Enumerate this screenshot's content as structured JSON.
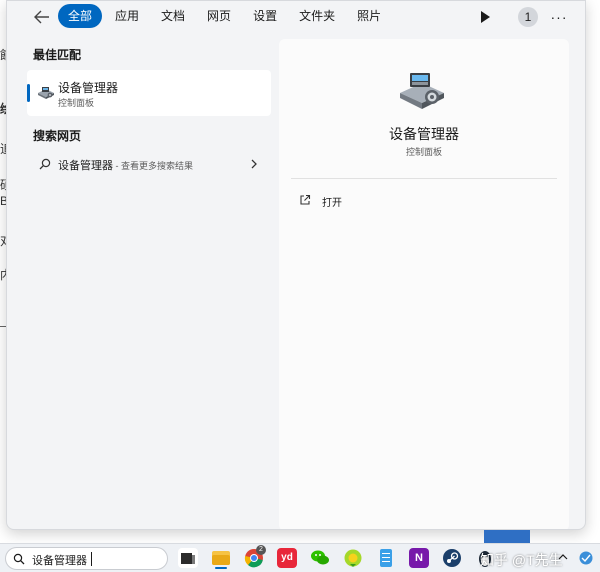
{
  "background_chars": [
    "餔",
    "绘",
    "追",
    "硕",
    "B",
    "对",
    "内"
  ],
  "topbar": {
    "back_icon": "arrow-left-icon",
    "tabs": [
      {
        "label": "全部",
        "active": true
      },
      {
        "label": "应用",
        "active": false
      },
      {
        "label": "文档",
        "active": false
      },
      {
        "label": "网页",
        "active": false
      },
      {
        "label": "设置",
        "active": false
      },
      {
        "label": "文件夹",
        "active": false
      },
      {
        "label": "照片",
        "active": false
      }
    ],
    "play_icon": "play-icon",
    "count": "1",
    "more_label": "···"
  },
  "results": {
    "best_match_title": "最佳匹配",
    "best_match": {
      "name": "设备管理器",
      "subtitle": "控制面板"
    },
    "web_title": "搜索网页",
    "web_result": {
      "query": "设备管理器",
      "hint": " - 查看更多搜索结果"
    }
  },
  "detail": {
    "title": "设备管理器",
    "subtitle": "控制面板",
    "open_label": "打开"
  },
  "taskbar": {
    "search_value": "设备管理器",
    "chrome_badge": "2",
    "watermark": "知乎 @T先生"
  },
  "colors": {
    "accent": "#0067c0",
    "flyout_bg": "#f3f4f6",
    "taskbar_bg": "#eef1f5"
  }
}
